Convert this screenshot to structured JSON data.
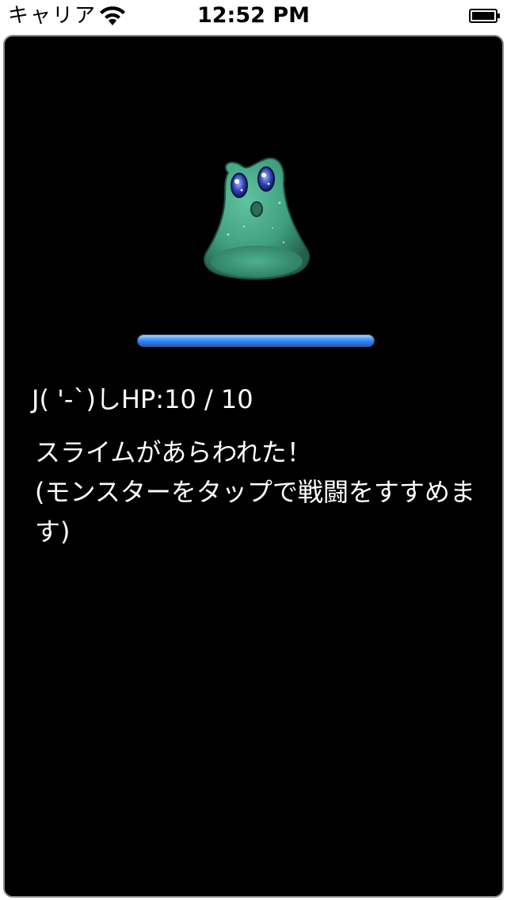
{
  "status_bar": {
    "carrier": "キャリア",
    "time": "12:52 PM",
    "battery_level": 1.0
  },
  "game": {
    "monster_name": "スライム",
    "hp_label": "J( '-`)しHP:10 / 10",
    "hp_current": 10,
    "hp_max": 10,
    "hp_bar_color": "#3b8cf5",
    "message_line1": "スライムがあらわれた！",
    "message_line2": "(モンスターをタップで戦闘をすすめます)"
  },
  "colors": {
    "screen_background": "#000000",
    "text": "#ffffff",
    "monster_body": "#3f9e7f"
  }
}
